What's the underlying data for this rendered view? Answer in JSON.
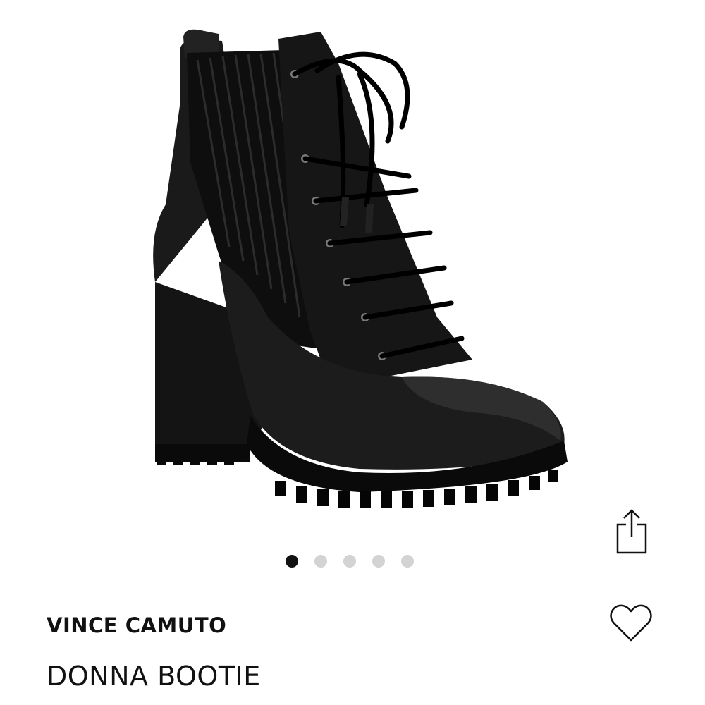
{
  "product": {
    "brand": "VINCE CAMUTO",
    "title": "DONNA BOOTIE",
    "image_subject": "black lace-up heeled bootie"
  },
  "carousel": {
    "total_images": 5,
    "active_index": 0
  },
  "actions": {
    "share_icon": "share-icon",
    "favorite_icon": "heart-icon"
  },
  "colors": {
    "text": "#111111",
    "dot_inactive": "#d3d3d3",
    "dot_active": "#111111"
  }
}
